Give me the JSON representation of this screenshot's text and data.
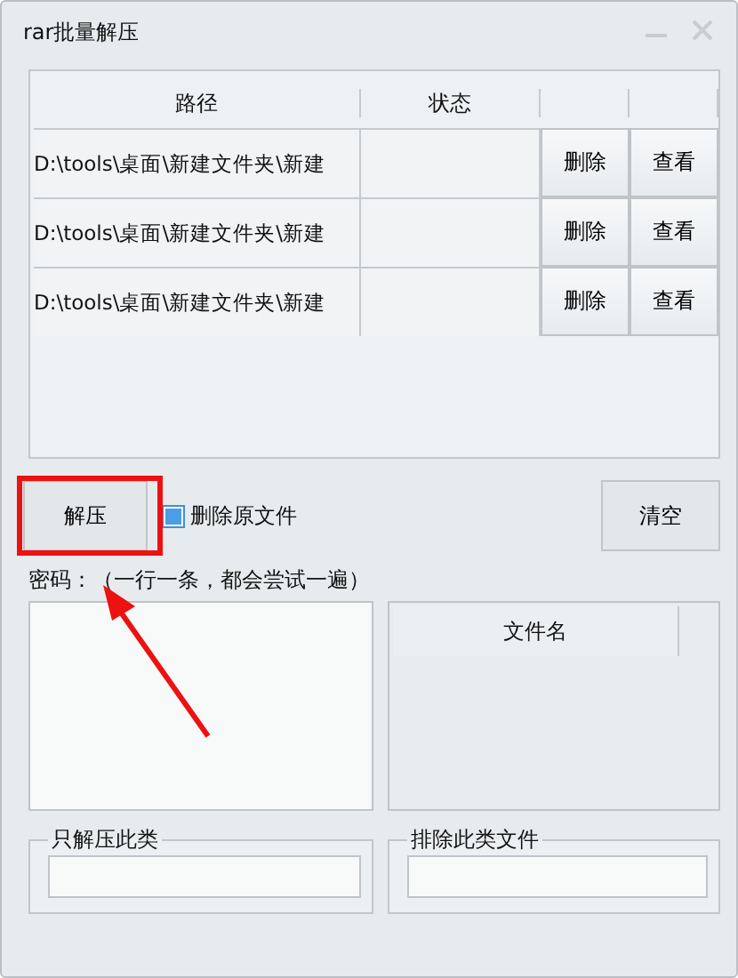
{
  "window": {
    "title": "rar批量解压"
  },
  "table": {
    "columns": [
      "路径",
      "状态"
    ],
    "rows": [
      {
        "path": "D:\\tools\\桌面\\新建文件夹\\新建",
        "delete": "删除",
        "view": "查看"
      },
      {
        "path": "D:\\tools\\桌面\\新建文件夹\\新建",
        "delete": "删除",
        "view": "查看"
      },
      {
        "path": "D:\\tools\\桌面\\新建文件夹\\新建",
        "delete": "删除",
        "view": "查看"
      }
    ]
  },
  "extract_button": "解压",
  "delete_original": {
    "label": "删除原文件",
    "checked": true
  },
  "clear_button": "清空",
  "password": {
    "label": "密码：（一行一条，都会尝试一遍）"
  },
  "file_list": {
    "columns": [
      "文件名"
    ]
  },
  "groups": [
    {
      "title": "只解压此类"
    },
    {
      "title": "排除此类文件"
    }
  ]
}
